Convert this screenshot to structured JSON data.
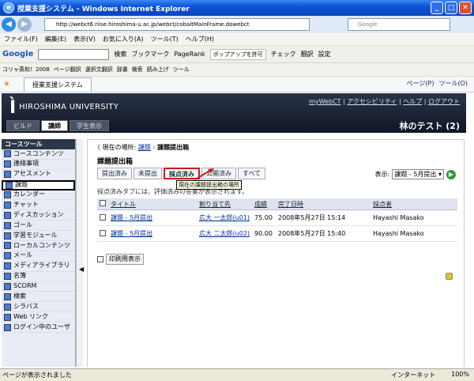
{
  "window": {
    "title": "授業支援システム - Windows Internet Explorer",
    "url": "http://webct6.riise.hiroshima-u.ac.jp/webct/cobaltMainFrame.dowebct",
    "search_placeholder": "Google"
  },
  "menu": [
    "ファイル(F)",
    "編集(E)",
    "表示(V)",
    "お気に入り(A)",
    "ツール(T)",
    "ヘルプ(H)"
  ],
  "toolbar": {
    "google": "Google",
    "search": "検索",
    "bookmark": "ブックマーク",
    "pagerank": "PageRank",
    "popup": "ポップアップを許可",
    "check": "チェック",
    "translate": "翻訳",
    "settings": "設定"
  },
  "links": {
    "word": "コリャ英和！2008",
    "translate": "ページ翻訳",
    "select": "選択文翻訳",
    "dict": "辞書",
    "search": "検索",
    "read": "読み上げ",
    "tools": "ツール"
  },
  "tab": {
    "label": "授業支援システム",
    "page": "ページ(P)",
    "tools": "ツール(O)"
  },
  "header": {
    "logo": "Ì",
    "university": "HIROSHIMA UNIVERSITY",
    "links": [
      "myWebCT",
      "アクセシビリティ",
      "ヘルプ",
      "ログアウト"
    ],
    "roles": [
      "ビルド",
      "講師",
      "学生表示"
    ],
    "user": "林のテスト (2)"
  },
  "sidebar": {
    "title": "コースツール",
    "items": [
      "コースコンテンツ",
      "連絡事項",
      "アセスメント",
      "課題",
      "カレンダー",
      "チャット",
      "ディスカッション",
      "ゴール",
      "学習モジュール",
      "ローカルコンテンツ",
      "メール",
      "メディアライブラリ",
      "名簿",
      "SCORM",
      "検索",
      "シラバス",
      "Web リンク",
      "ログイン中のユーザ"
    ]
  },
  "breadcrumb": {
    "prefix": "現在の場所:",
    "parent": "課題",
    "current": "課題提出箱"
  },
  "page": {
    "title": "課題提出箱",
    "tabs": [
      "提出済み",
      "未提出",
      "採点済み",
      "公開済み",
      "すべて"
    ],
    "display_label": "表示:",
    "display_value": "課題 - 5月提出",
    "tooltip": "現在の課題提出箱の場所",
    "note": "採点済みタブには、評価済みの答案が表示されます。"
  },
  "table": {
    "headers": [
      "タイトル",
      "割り当て先",
      "成績",
      "完了日時",
      "採点者"
    ],
    "rows": [
      [
        "課題 - 5月提出",
        "広大 一太郎(u01)",
        "75.00",
        "2008年5月27日 15:14",
        "Hayashi Masako"
      ],
      [
        "課題 - 5月提出",
        "広大 二太郎(u02)",
        "90.00",
        "2008年5月27日 15:40",
        "Hayashi Masako"
      ]
    ],
    "print": "印刷用表示"
  },
  "status": {
    "left": "ページが表示されました",
    "zone": "インターネット",
    "zoom": "100%"
  },
  "colors": {
    "accent": "#0a55d8",
    "header": "#1b2436",
    "highlight": "#d01818"
  }
}
